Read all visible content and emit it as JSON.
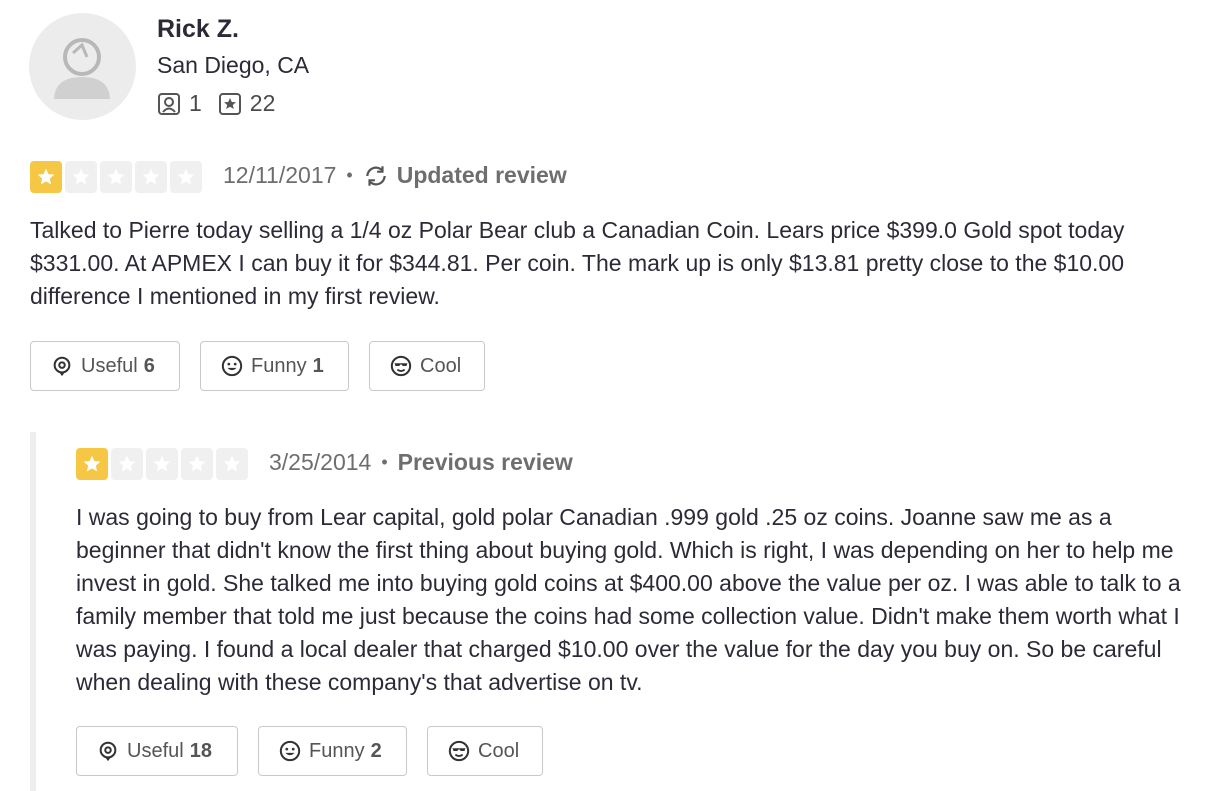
{
  "user": {
    "name": "Rick Z.",
    "location": "San Diego, CA",
    "friends_count": "1",
    "reviews_count": "22"
  },
  "reviews": [
    {
      "rating": 1,
      "date": "12/11/2017",
      "status": "Updated review",
      "text": "Talked to Pierre today selling a 1/4 oz Polar Bear club a Canadian Coin. Lears price $399.0 Gold spot today $331.00. At APMEX I can buy it for $344.81. Per coin. The mark up is only $13.81 pretty close to the $10.00 difference I mentioned in my first review.",
      "useful_label": "Useful",
      "useful_count": "6",
      "funny_label": "Funny",
      "funny_count": "1",
      "cool_label": "Cool"
    },
    {
      "rating": 1,
      "date": "3/25/2014",
      "status": "Previous review",
      "text": "I was going to buy from Lear capital, gold polar Canadian .999 gold .25 oz coins. Joanne saw me as a beginner that didn't know the first thing about buying gold. Which is right, I was depending on her to help me invest in gold. She talked me into buying gold coins at $400.00 above the value per oz.  I was able to talk to a family member that told me just because the coins had some collection value. Didn't make them worth what I was paying. I found a local dealer that charged $10.00 over the value for the day you buy on. So be careful when dealing with these company's that advertise on tv.",
      "useful_label": "Useful",
      "useful_count": "18",
      "funny_label": "Funny",
      "funny_count": "2",
      "cool_label": "Cool"
    }
  ],
  "colors": {
    "star_on": "#f5c744",
    "star_off": "#f0f0f0",
    "text": "#2d2a38"
  },
  "icons": [
    "user-avatar-icon",
    "friends-icon",
    "reviews-star-icon",
    "star-icon",
    "sync-icon",
    "useful-icon",
    "funny-icon",
    "cool-icon"
  ]
}
